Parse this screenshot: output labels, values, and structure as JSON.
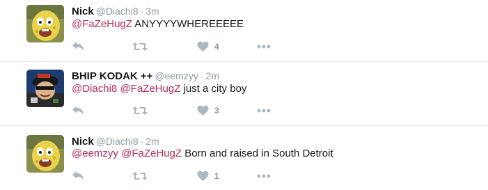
{
  "tweets": [
    {
      "name": "Nick",
      "handle": "@Diachi8",
      "separator": "·",
      "time": "3m",
      "mentions": [
        "@FaZeHugZ"
      ],
      "text": "ANYYYYWHEREEEEE",
      "likes": "4",
      "avatar": "spongegar-avatar"
    },
    {
      "name": "BHIP KODAK ++",
      "handle": "@eemzyy",
      "separator": "·",
      "time": "2m",
      "mentions": [
        "@Diachi8",
        "@FaZeHugZ"
      ],
      "text": "just a city boy",
      "likes": "3",
      "avatar": "cartoon-avatar"
    },
    {
      "name": "Nick",
      "handle": "@Diachi8",
      "separator": "·",
      "time": "2m",
      "mentions": [
        "@eemzyy",
        "@FaZeHugZ"
      ],
      "text": "Born and raised in South Detroit",
      "likes": "1",
      "avatar": "spongegar-avatar"
    }
  ],
  "icons": {
    "reply": "reply-icon",
    "retweet": "retweet-icon",
    "like": "heart-icon",
    "more": "more-icon"
  },
  "colors": {
    "mention": "#ba2a55",
    "meta": "#8899a6",
    "icon": "#aab8c2"
  }
}
